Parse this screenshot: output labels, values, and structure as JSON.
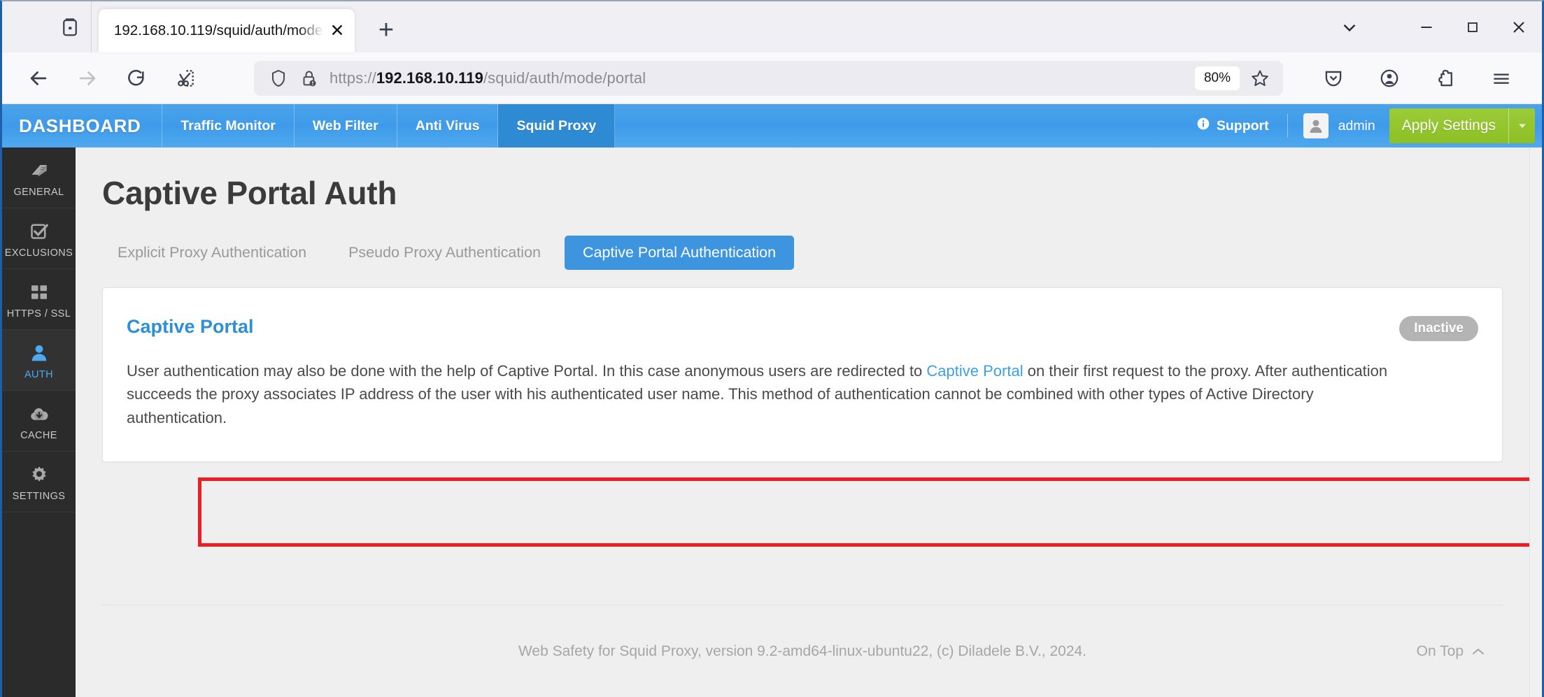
{
  "browser": {
    "tab": {
      "title": "192.168.10.119/squid/auth/mode/portal",
      "close_label": "✕"
    },
    "new_tab_label": "+",
    "window_controls": {
      "list_tabs": "list-all-tabs",
      "minimize": "—",
      "maximize": "□",
      "close": "✕"
    },
    "toolbar": {
      "back": "back",
      "forward": "forward",
      "reload": "reload",
      "screenshot": "screenshot",
      "url_scheme": "https://",
      "url_host": "192.168.10.119",
      "url_path": "/squid/auth/mode/portal",
      "zoom_level": "80%",
      "bookmark": "bookmark-star",
      "pocket": "save-to-pocket",
      "account": "account",
      "extensions": "extensions",
      "menu": "application-menu"
    }
  },
  "topnav": {
    "brand": "DASHBOARD",
    "items": [
      {
        "label": "Traffic Monitor",
        "active": false
      },
      {
        "label": "Web Filter",
        "active": false
      },
      {
        "label": "Anti Virus",
        "active": false
      },
      {
        "label": "Squid Proxy",
        "active": true
      }
    ],
    "support_label": "Support",
    "user_name": "admin",
    "apply_label": "Apply Settings",
    "apply_caret": "▾"
  },
  "sidebar": {
    "items": [
      {
        "label": "GENERAL",
        "icon": "book-icon",
        "active": false
      },
      {
        "label": "EXCLUSIONS",
        "icon": "checkbox-icon",
        "active": false
      },
      {
        "label": "HTTPS / SSL",
        "icon": "grid-icon",
        "active": false
      },
      {
        "label": "AUTH",
        "icon": "user-icon",
        "active": true
      },
      {
        "label": "CACHE",
        "icon": "cloud-download-icon",
        "active": false
      },
      {
        "label": "SETTINGS",
        "icon": "gear-icon",
        "active": false
      }
    ]
  },
  "page": {
    "title": "Captive Portal Auth",
    "tabs": [
      {
        "label": "Explicit Proxy Authentication",
        "active": false
      },
      {
        "label": "Pseudo Proxy Authentication",
        "active": false
      },
      {
        "label": "Captive Portal Authentication",
        "active": true
      }
    ],
    "card": {
      "title": "Captive Portal",
      "status_badge": "Inactive",
      "text_part1": "User authentication may also be done with the help of Captive Portal. In this case anonymous users are redirected to ",
      "link_label": "Captive Portal",
      "text_part2": " on their first request to the proxy. After authentication succeeds the proxy associates IP address of the user with his authenticated user name. This method of authentication cannot be combined with other types of Active Directory authentication."
    }
  },
  "footer": {
    "text": "Web Safety for Squid Proxy, version 9.2-amd64-linux-ubuntu22, (c) Diladele B.V., 2024.",
    "on_top_label": "On Top",
    "on_top_caret": "⌃"
  },
  "colors": {
    "brand_blue": "#3f9bea",
    "active_nav": "#2f8ad4",
    "accent_green": "#8cc024",
    "link_blue": "#3da0e3",
    "highlight_red": "#ee1c25",
    "badge_gray": "#b4b4b4"
  }
}
